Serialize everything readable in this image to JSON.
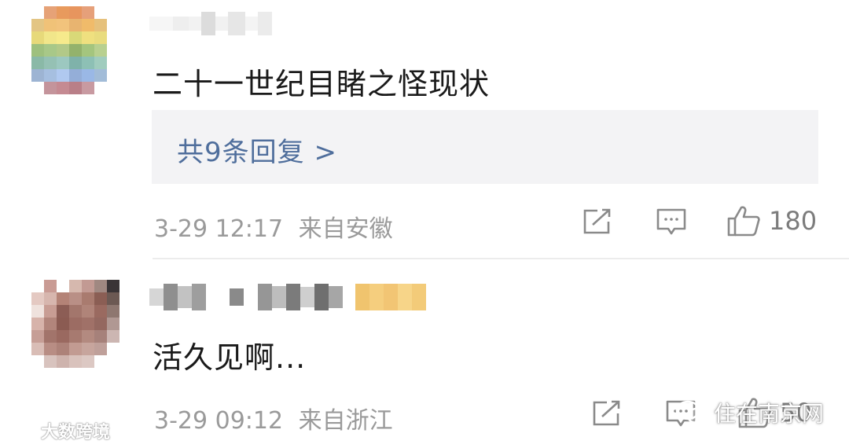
{
  "comments": [
    {
      "text": "二十一世纪目睹之怪现状",
      "replies_label": "共9条回复 >",
      "timestamp": "3-29 12:17",
      "location": "来自安徽",
      "like_count": "180"
    },
    {
      "text": "活久见啊...",
      "timestamp": "3-29 09:12",
      "location": "来自浙江",
      "like_count": "50"
    }
  ],
  "icons": {
    "share": "share-icon",
    "comment": "comment-icon",
    "like": "thumbs-up-icon"
  },
  "watermarks": {
    "left": "大数跨境",
    "right": "住在南京网"
  },
  "colors": {
    "reply_link": "#4f6e9c",
    "meta_text": "#9a9a9a",
    "reply_box_bg": "#f3f3f5",
    "icon_stroke": "#8a8a8a"
  }
}
